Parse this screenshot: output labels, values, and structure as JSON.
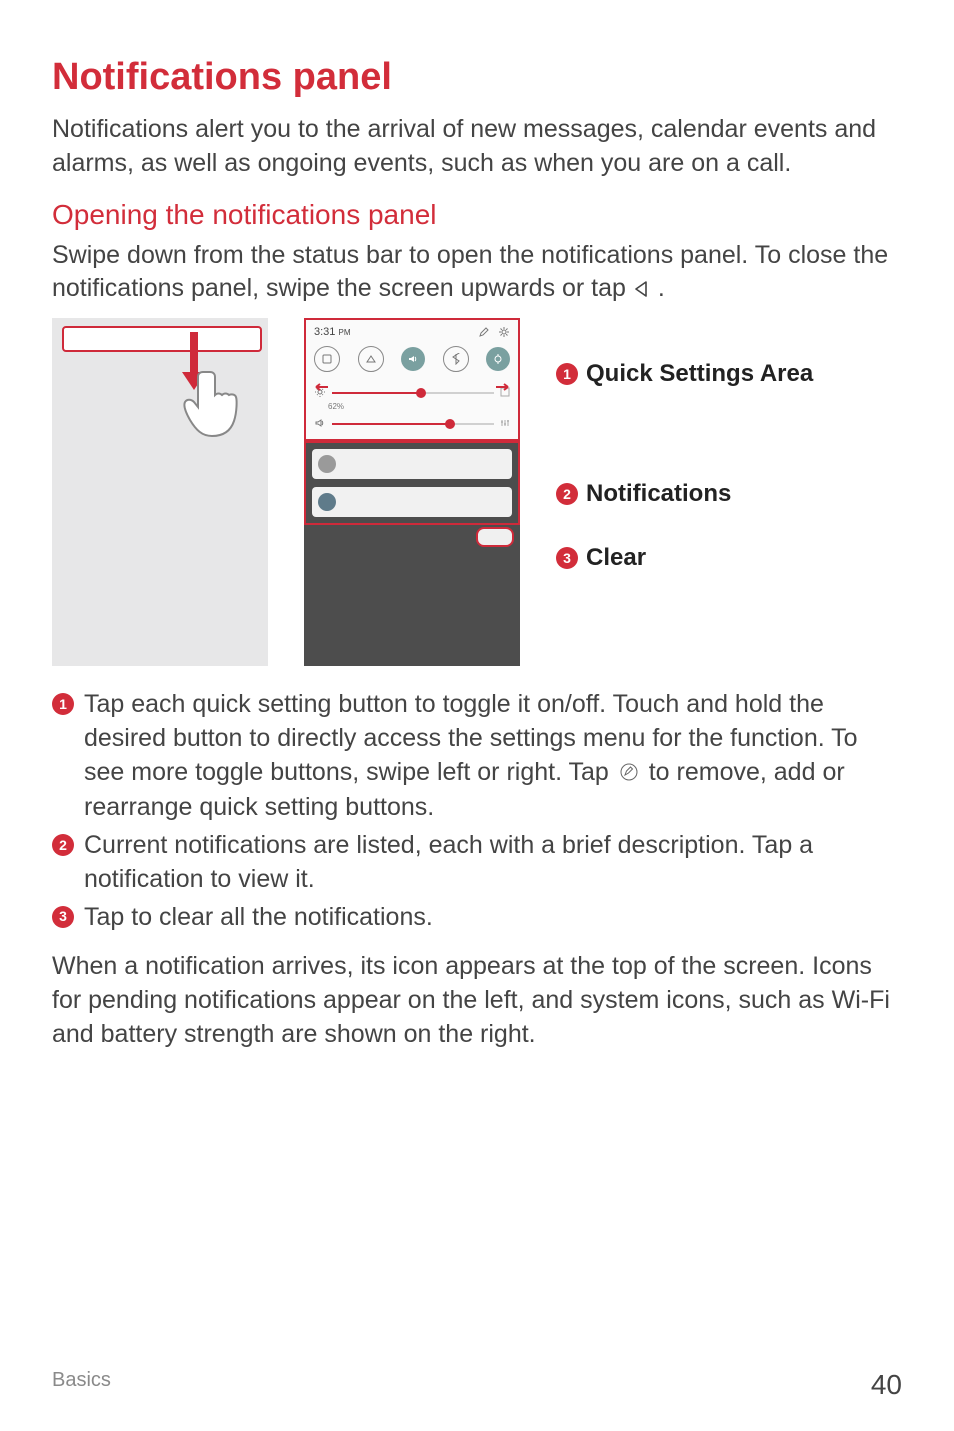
{
  "title": "Notifications panel",
  "intro": "Notifications alert you to the arrival of new messages, calendar events and alarms, as well as ongoing events, such as when you are on a call.",
  "subhead": "Opening the notifications panel",
  "open_text_a": "Swipe down from the status bar to open the notifications panel. To close the notifications panel, swipe the screen upwards or tap ",
  "open_text_b": ".",
  "panel": {
    "time": "3:31",
    "time_suffix": "PM",
    "brightness_label": "62%"
  },
  "callouts": {
    "c1": "Quick Settings Area",
    "c2": "Notifications",
    "c3": "Clear"
  },
  "bullets": {
    "b1a": "Tap each quick setting button to toggle it on/off. Touch and hold the desired button to directly access the settings menu for the function. To see more toggle buttons, swipe left or right. Tap ",
    "b1b": " to remove, add or rearrange quick setting buttons.",
    "b2": "Current notifications are listed, each with a brief description. Tap a notification to view it.",
    "b3": "Tap to clear all the notifications."
  },
  "para_after": "When a notification arrives, its icon appears at the top of the screen. Icons for pending notifications appear on the left, and system icons, such as Wi-Fi and battery strength are shown on the right.",
  "footer": {
    "section": "Basics",
    "page": "40"
  },
  "numbers": {
    "one": "1",
    "two": "2",
    "three": "3"
  }
}
